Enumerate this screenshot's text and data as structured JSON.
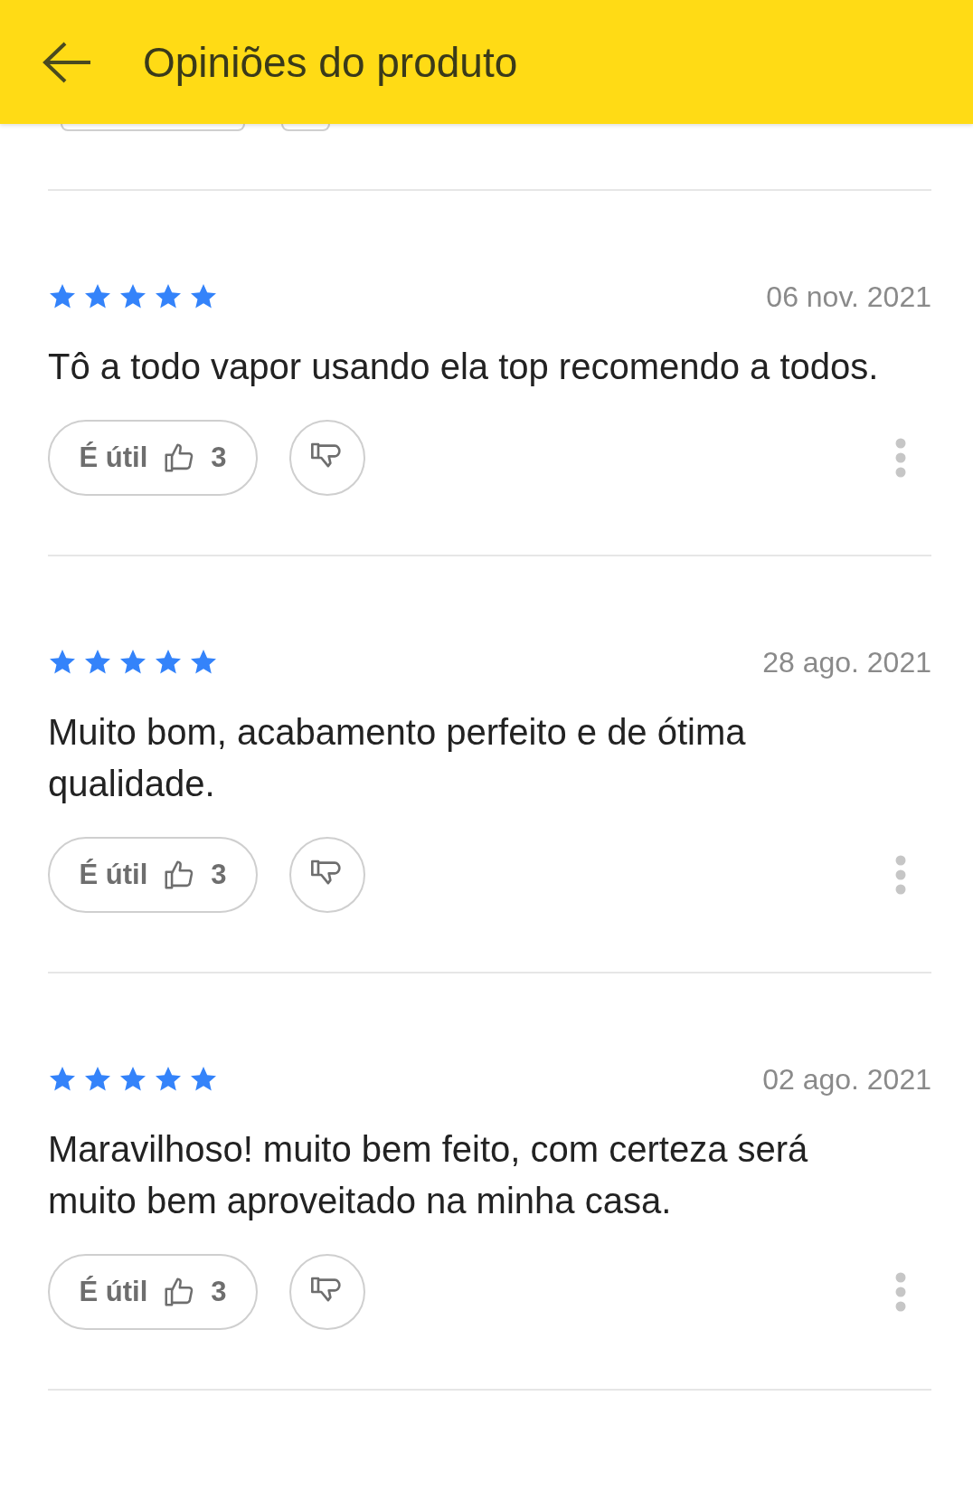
{
  "header": {
    "title": "Opiniões do produto"
  },
  "reviews": [
    {
      "stars": 5,
      "date": "06 nov. 2021",
      "text": "Tô a todo vapor usando ela top recomendo a todos.",
      "helpful_label": "É útil",
      "helpful_count": "3"
    },
    {
      "stars": 5,
      "date": "28 ago. 2021",
      "text": "Muito bom, acabamento perfeito e de ótima qualidade.",
      "helpful_label": "É útil",
      "helpful_count": "3"
    },
    {
      "stars": 5,
      "date": "02 ago. 2021",
      "text": "Maravilhoso! muito bem feito, com certeza será muito bem aproveitado na minha casa.",
      "helpful_label": "É útil",
      "helpful_count": "3"
    }
  ]
}
